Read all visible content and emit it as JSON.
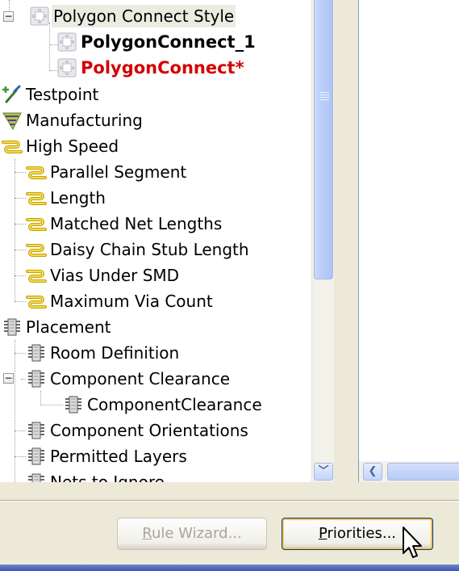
{
  "tree": {
    "items": [
      {
        "label": "Polygon Connect Style",
        "icon": "polygon-connect-icon",
        "style": "group"
      },
      {
        "label": "PolygonConnect_1",
        "icon": "polygon-connect-icon",
        "style": "bold"
      },
      {
        "label": "PolygonConnect*",
        "icon": "polygon-connect-icon",
        "style": "bold-red"
      },
      {
        "label": "Testpoint",
        "icon": "testpoint-icon",
        "style": "normal"
      },
      {
        "label": "Manufacturing",
        "icon": "manufacturing-icon",
        "style": "normal"
      },
      {
        "label": "High Speed",
        "icon": "high-speed-icon",
        "style": "normal"
      },
      {
        "label": "Parallel Segment",
        "icon": "high-speed-icon",
        "style": "normal"
      },
      {
        "label": "Length",
        "icon": "high-speed-icon",
        "style": "normal"
      },
      {
        "label": "Matched Net Lengths",
        "icon": "high-speed-icon",
        "style": "normal"
      },
      {
        "label": "Daisy Chain Stub Length",
        "icon": "high-speed-icon",
        "style": "normal"
      },
      {
        "label": "Vias Under SMD",
        "icon": "high-speed-icon",
        "style": "normal"
      },
      {
        "label": "Maximum Via Count",
        "icon": "high-speed-icon",
        "style": "normal"
      },
      {
        "label": "Placement",
        "icon": "placement-icon",
        "style": "normal"
      },
      {
        "label": "Room Definition",
        "icon": "placement-icon",
        "style": "normal"
      },
      {
        "label": "Component Clearance",
        "icon": "placement-icon",
        "style": "normal"
      },
      {
        "label": "ComponentClearance",
        "icon": "placement-icon",
        "style": "normal"
      },
      {
        "label": "Component Orientations",
        "icon": "placement-icon",
        "style": "normal"
      },
      {
        "label": "Permitted Layers",
        "icon": "placement-icon",
        "style": "normal"
      },
      {
        "label": "Nets to Ignore",
        "icon": "placement-icon",
        "style": "normal"
      }
    ]
  },
  "buttons": {
    "rule_wizard": {
      "mnemonic": "R",
      "rest": "ule Wizard..."
    },
    "priorities": {
      "mnemonic": "P",
      "rest": "riorities..."
    }
  },
  "icons": {
    "collapse": "−",
    "scroll_down": "﹀",
    "scroll_left": "❮"
  },
  "colors": {
    "highlight_red": "#d40000",
    "scroll_blue": "#b9cdf8",
    "status_stripe": "#3d58b6"
  }
}
